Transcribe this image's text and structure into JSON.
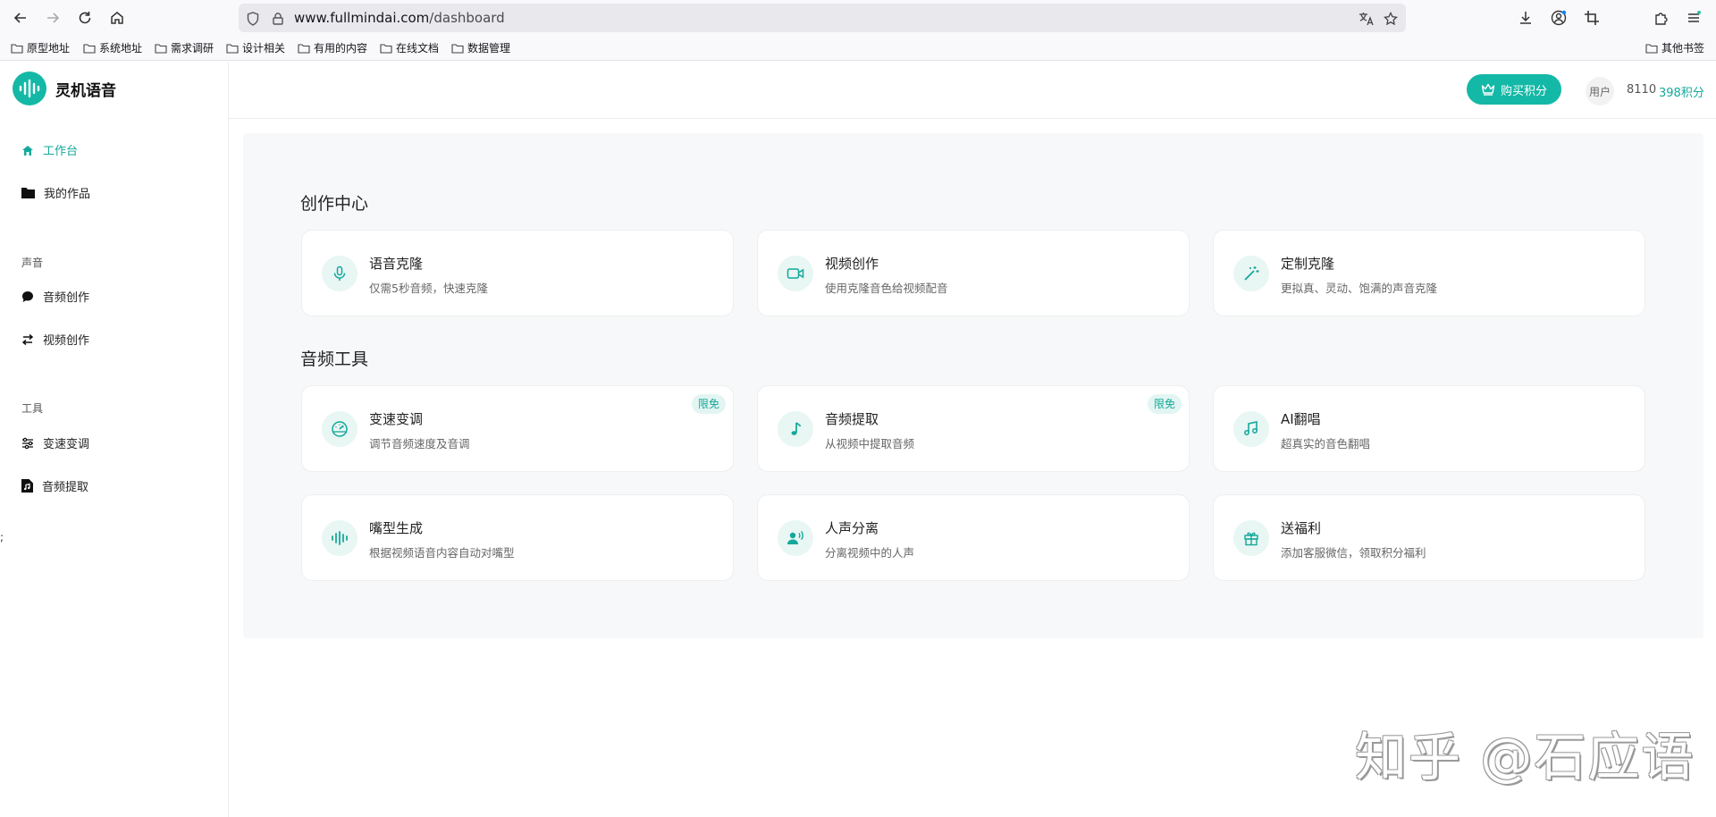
{
  "browser": {
    "url_host": "www.fullmindai.com",
    "url_path": "/dashboard",
    "bookmarks": [
      "原型地址",
      "系统地址",
      "需求调研",
      "设计相关",
      "有用的内容",
      "在线文档",
      "数据管理"
    ],
    "other_bookmarks": "其他书签"
  },
  "app": {
    "name": "灵机语音",
    "accent": "#14b8a6"
  },
  "sidebar": {
    "workbench": "工作台",
    "my_works": "我的作品",
    "group_voice": "声音",
    "audio_create": "音频创作",
    "video_create": "视频创作",
    "group_tools": "工具",
    "speed_pitch": "变速变调",
    "audio_extract": "音频提取"
  },
  "header": {
    "buy_label": "购买积分",
    "user_avatar_text": "用户",
    "user_id": "8110",
    "points": "398积分"
  },
  "main": {
    "section1_title": "创作中心",
    "section2_title": "音频工具",
    "cards": [
      {
        "title": "语音克隆",
        "desc": "仅需5秒音频，快速克隆",
        "icon": "microphone-icon"
      },
      {
        "title": "视频创作",
        "desc": "使用克隆音色给视频配音",
        "icon": "video-camera-icon"
      },
      {
        "title": "定制克隆",
        "desc": "更拟真、灵动、饱满的声音克隆",
        "icon": "magic-wand-icon"
      },
      {
        "title": "变速变调",
        "desc": "调节音频速度及音调",
        "icon": "gauge-icon",
        "badge": "限免"
      },
      {
        "title": "音频提取",
        "desc": "从视频中提取音频",
        "icon": "music-note-icon",
        "badge": "限免"
      },
      {
        "title": "AI翻唱",
        "desc": "超真实的音色翻唱",
        "icon": "music-notes-icon"
      },
      {
        "title": "嘴型生成",
        "desc": "根据视频语音内容自动对嘴型",
        "icon": "waveform-icon"
      },
      {
        "title": "人声分离",
        "desc": "分离视频中的人声",
        "icon": "voice-user-icon"
      },
      {
        "title": "送福利",
        "desc": "添加客服微信，领取积分福利",
        "icon": "gift-icon"
      }
    ]
  },
  "watermark": "知乎 @石应语",
  "stray_char": ";"
}
